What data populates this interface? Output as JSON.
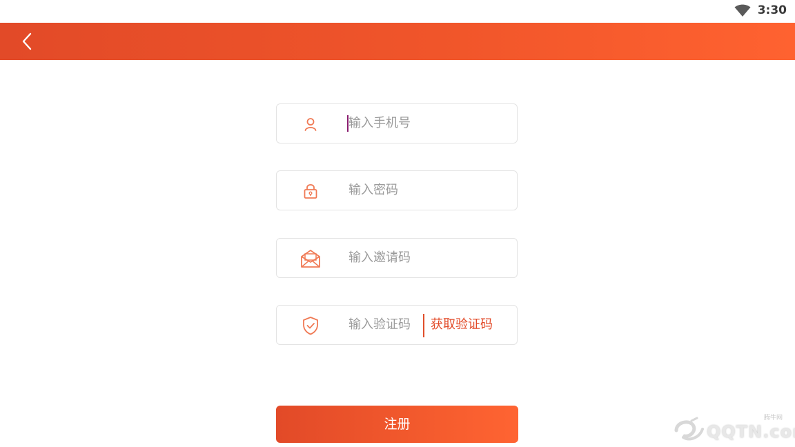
{
  "status_bar": {
    "time": "3:30",
    "wifi_icon": "wifi-icon"
  },
  "app_bar": {
    "back_icon": "chevron-left-icon",
    "colors": {
      "start": "#e24a28",
      "end": "#ff6230"
    }
  },
  "form": {
    "phone": {
      "placeholder": "输入手机号",
      "icon": "user-icon"
    },
    "password": {
      "placeholder": "输入密码",
      "icon": "lock-icon"
    },
    "invite_code": {
      "placeholder": "输入邀请码",
      "icon": "envelope-icon"
    },
    "verify_code": {
      "placeholder": "输入验证码",
      "icon": "shield-check-icon",
      "get_code_label": "获取验证码"
    },
    "register_label": "注册"
  },
  "watermark": {
    "small_text": "腾牛网",
    "text": "QQTN.com"
  }
}
